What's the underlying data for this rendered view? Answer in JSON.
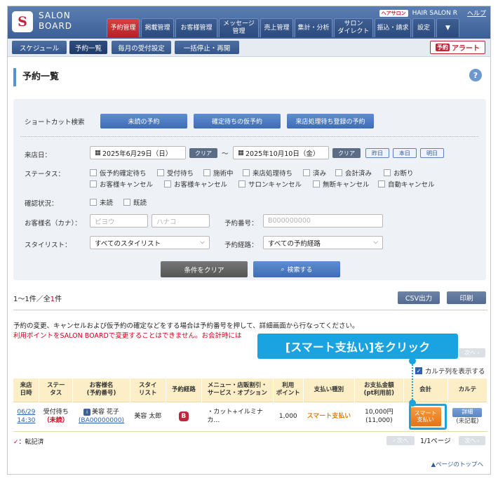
{
  "header": {
    "logo_mark": "S",
    "logo_line1": "SALON",
    "logo_line2": "BOARD",
    "hair_badge": "ヘアサロン",
    "salon_name": "HAIR SALON R",
    "help_link": "ヘルプ",
    "nav": [
      {
        "label": "予約管理",
        "active": true
      },
      {
        "label": "掲載管理",
        "active": false
      },
      {
        "label": "お客様管理",
        "active": false
      },
      {
        "label": "メッセージ\n管理",
        "active": false
      },
      {
        "label": "売上管理",
        "active": false
      },
      {
        "label": "集計・分析",
        "active": false
      },
      {
        "label": "サロン\nダイレクト",
        "active": false
      },
      {
        "label": "振込・請求",
        "active": false
      },
      {
        "label": "設定",
        "active": false
      },
      {
        "label": "▼",
        "active": false
      }
    ]
  },
  "subnav": {
    "tabs": [
      "スケジュール",
      "予約一覧",
      "毎月の受付設定",
      "一括停止・再開"
    ],
    "alert_tag": "予約",
    "alert_label": "アラート"
  },
  "page": {
    "title": "予約一覧",
    "help_icon": "?"
  },
  "shortcut": {
    "label": "ショートカット検索",
    "buttons": [
      "未読の予約",
      "確定待ちの仮予約",
      "来店処理待ち登録の予約"
    ]
  },
  "visit_date": {
    "label": "来店日：",
    "from": "2025年6月29日（日）",
    "to": "2025年10月10日（金）",
    "clear": "クリア",
    "tilde": "〜",
    "quick": [
      "昨日",
      "本日",
      "明日"
    ]
  },
  "status": {
    "label": "ステータス：",
    "options": [
      "仮予約確定待ち",
      "受付待ち",
      "施術中",
      "来店処理待ち",
      "済み",
      "会計済み",
      "お断り",
      "お客様キャンセル",
      "お客様キャンセル",
      "サロンキャンセル",
      "無断キャンセル",
      "自動キャンセル"
    ]
  },
  "confirm": {
    "label": "確認状況：",
    "options": [
      "未読",
      "既読"
    ]
  },
  "customer": {
    "label": "お客様名（カナ）：",
    "last_placeholder": "ピヨウ",
    "first_placeholder": "ハナコ",
    "number_label": "予約番号：",
    "number_placeholder": "B000000000"
  },
  "stylist": {
    "label": "スタイリスト：",
    "value": "すべてのスタイリスト",
    "route_label": "予約経路：",
    "route_value": "すべての予約経路"
  },
  "actions": {
    "clear": "条件をクリア",
    "search": "検索する"
  },
  "results": {
    "prefix": "1〜1件／全",
    "total": "1",
    "suffix": "件",
    "csv": "CSV出力",
    "print": "印刷",
    "note1": "予約の変更、キャンセルおよび仮予約の確定などをする場合は予約番号を押して、詳細画面から行なってください。",
    "note2": "利用ポイントをSALON BOARDで変更することはできません。お会計時には",
    "next": "次へ ›",
    "prev": "‹ 次へ",
    "karte_toggle": "カルテ列を表示する",
    "pages": "1/1ページ"
  },
  "table": {
    "headers": [
      "来店\n日時",
      "ステー\nタス",
      "お客様名\n(予約番号)",
      "スタイ\nリスト",
      "予約経路",
      "メニュー・店販割引・\nサービス・オプション",
      "利用\nポイント",
      "支払い種別",
      "お支払金額\n(pt利用前)",
      "会計",
      "カルテ"
    ],
    "row": {
      "date": "06/29",
      "time": "14:30",
      "status": "受付待ち",
      "status_sub": "（未読）",
      "customer_tag": "i",
      "customer": "美容 花子",
      "reservation_no": "(BA00000000)",
      "stylist": "美容 太郎",
      "route_mark": "B",
      "menu": "・カット+イルミナカ…",
      "points": "1,000",
      "payment_type": "スマート支払い",
      "amount": "10,000円",
      "amount_before": "(11,000)",
      "account_btn": "スマート\n支払い",
      "karte_btn": "詳細",
      "karte_sub": "(未記載)"
    }
  },
  "footer": {
    "transcribed_mark": "✓",
    "transcribed_label": "：転記済",
    "page_top": "ページのトップへ"
  },
  "callout": {
    "text": "[スマート支払い]をクリック"
  },
  "colors": {
    "brand": "#3b5f96",
    "active_nav": "#c0263a",
    "accent_callout": "#19a3e0",
    "smart_pay": "#e77414"
  }
}
